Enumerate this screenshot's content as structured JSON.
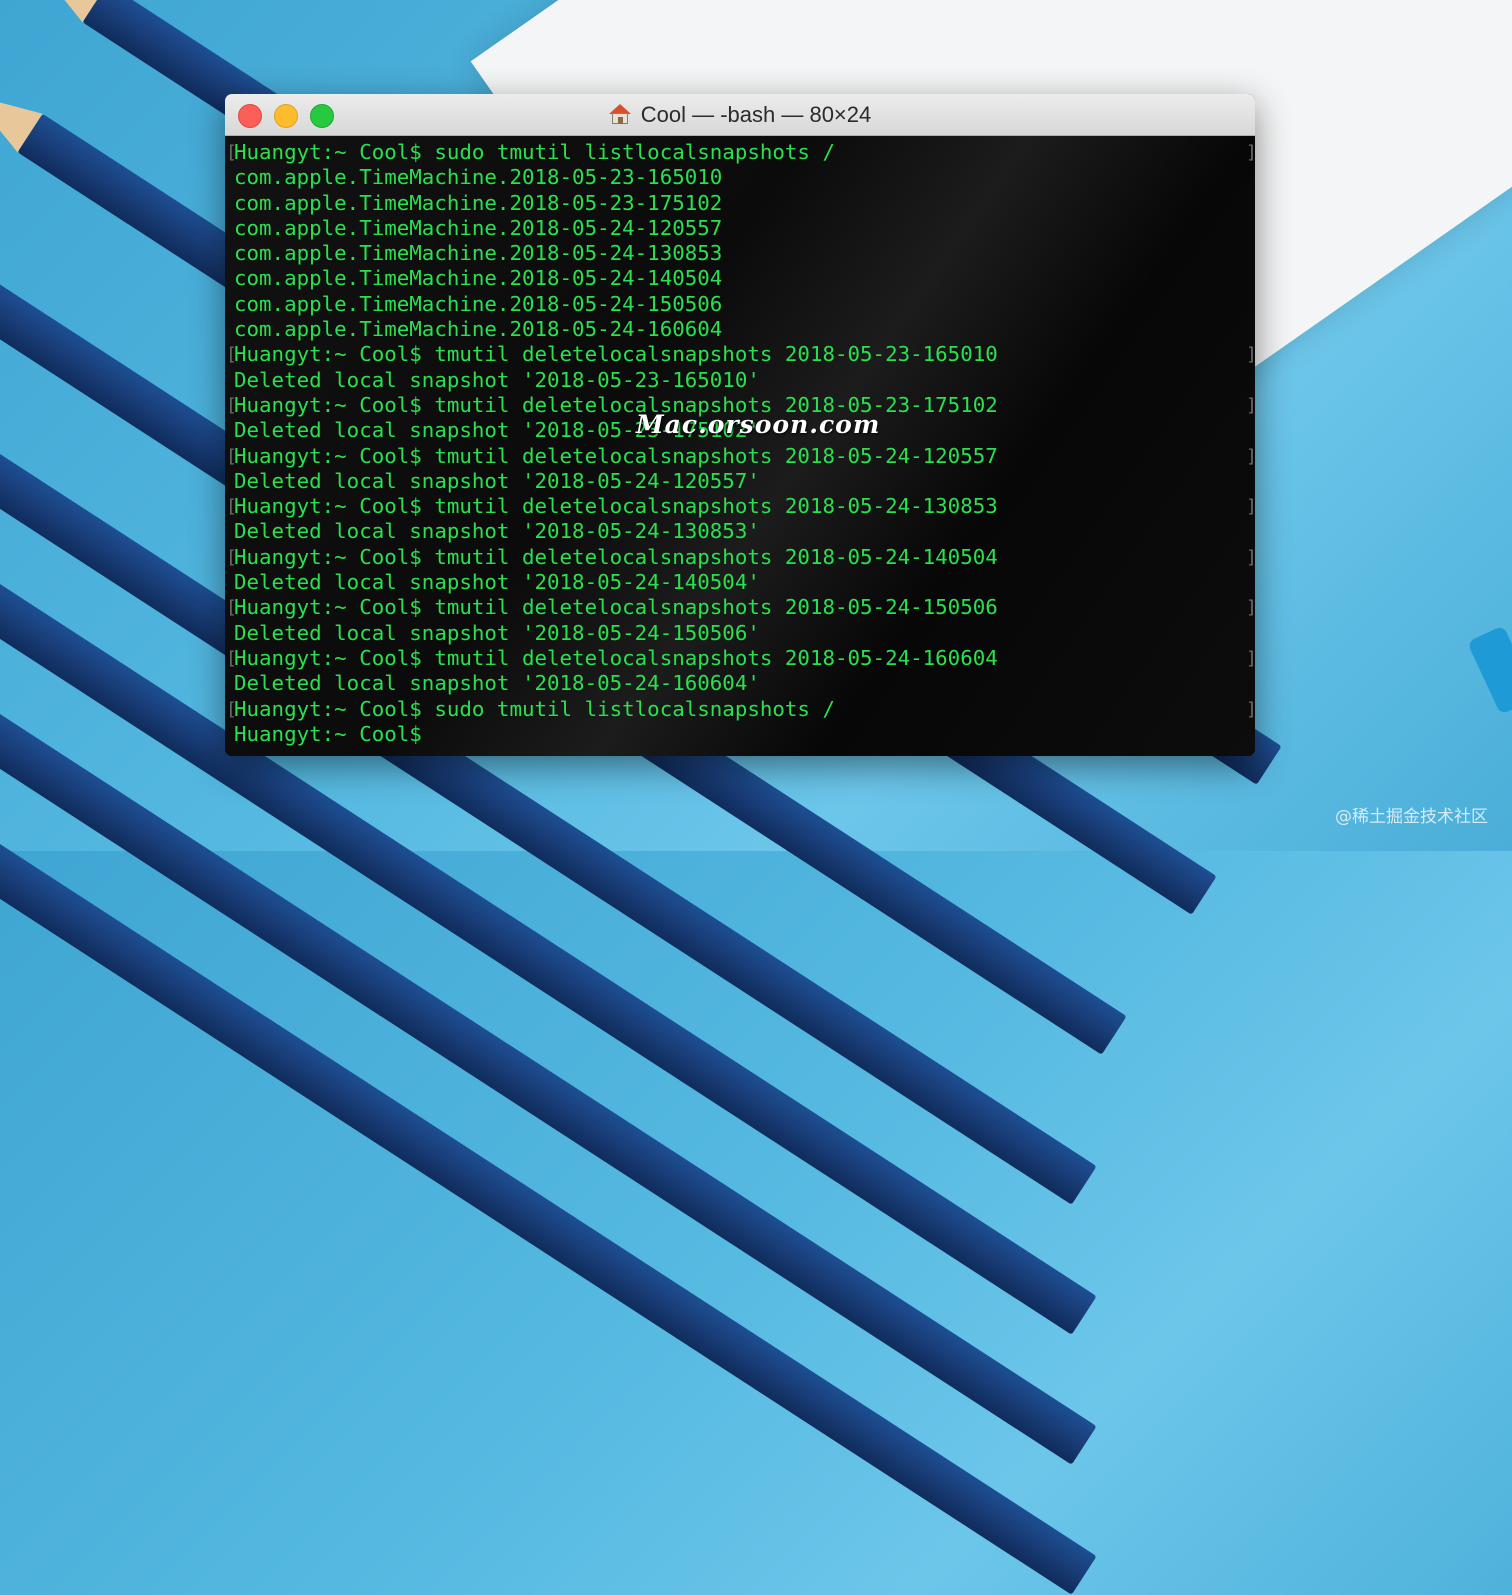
{
  "window": {
    "title": "Cool — -bash — 80×24"
  },
  "terminal": {
    "lines": [
      {
        "type": "prompt",
        "text": "Huangyt:~ Cool$ sudo tmutil listlocalsnapshots /"
      },
      {
        "type": "output",
        "text": "com.apple.TimeMachine.2018-05-23-165010"
      },
      {
        "type": "output",
        "text": "com.apple.TimeMachine.2018-05-23-175102"
      },
      {
        "type": "output",
        "text": "com.apple.TimeMachine.2018-05-24-120557"
      },
      {
        "type": "output",
        "text": "com.apple.TimeMachine.2018-05-24-130853"
      },
      {
        "type": "output",
        "text": "com.apple.TimeMachine.2018-05-24-140504"
      },
      {
        "type": "output",
        "text": "com.apple.TimeMachine.2018-05-24-150506"
      },
      {
        "type": "output",
        "text": "com.apple.TimeMachine.2018-05-24-160604"
      },
      {
        "type": "prompt",
        "text": "Huangyt:~ Cool$ tmutil deletelocalsnapshots 2018-05-23-165010"
      },
      {
        "type": "output",
        "text": "Deleted local snapshot '2018-05-23-165010'"
      },
      {
        "type": "prompt",
        "text": "Huangyt:~ Cool$ tmutil deletelocalsnapshots 2018-05-23-175102"
      },
      {
        "type": "output",
        "text": "Deleted local snapshot '2018-05-23-175102'"
      },
      {
        "type": "prompt",
        "text": "Huangyt:~ Cool$ tmutil deletelocalsnapshots 2018-05-24-120557"
      },
      {
        "type": "output",
        "text": "Deleted local snapshot '2018-05-24-120557'"
      },
      {
        "type": "prompt",
        "text": "Huangyt:~ Cool$ tmutil deletelocalsnapshots 2018-05-24-130853"
      },
      {
        "type": "output",
        "text": "Deleted local snapshot '2018-05-24-130853'"
      },
      {
        "type": "prompt",
        "text": "Huangyt:~ Cool$ tmutil deletelocalsnapshots 2018-05-24-140504"
      },
      {
        "type": "output",
        "text": "Deleted local snapshot '2018-05-24-140504'"
      },
      {
        "type": "prompt",
        "text": "Huangyt:~ Cool$ tmutil deletelocalsnapshots 2018-05-24-150506"
      },
      {
        "type": "output",
        "text": "Deleted local snapshot '2018-05-24-150506'"
      },
      {
        "type": "prompt",
        "text": "Huangyt:~ Cool$ tmutil deletelocalsnapshots 2018-05-24-160604"
      },
      {
        "type": "output",
        "text": "Deleted local snapshot '2018-05-24-160604'"
      },
      {
        "type": "prompt",
        "text": "Huangyt:~ Cool$ sudo tmutil listlocalsnapshots /"
      },
      {
        "type": "current",
        "text": "Huangyt:~ Cool$ "
      }
    ]
  },
  "overlay": {
    "watermark": "Mac.orsoon.com",
    "corner_mark": "@稀土掘金技术社区"
  },
  "colors": {
    "terminal_text": "#2be04e",
    "terminal_bg": "#0b0b0b",
    "close": "#fc5f57",
    "minimize": "#fdbc2e",
    "maximize": "#28c840"
  },
  "icons": {
    "title": "home-icon"
  }
}
